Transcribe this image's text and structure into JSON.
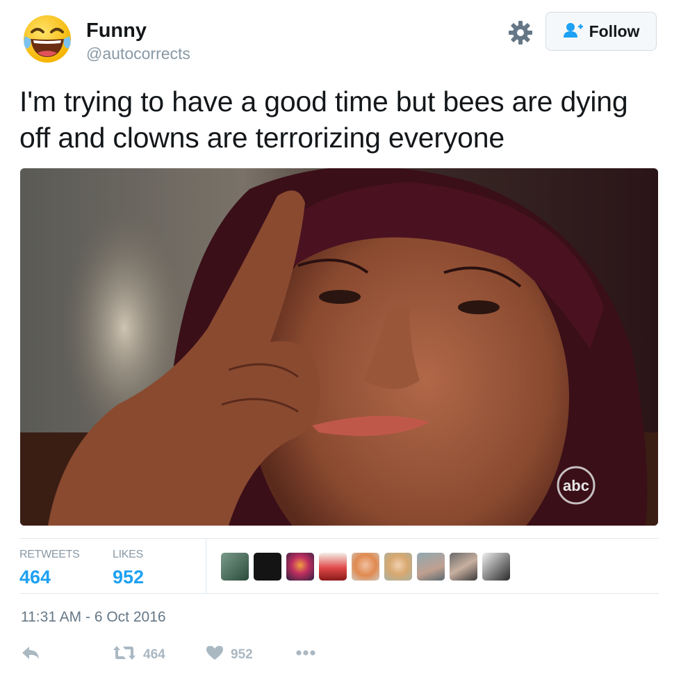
{
  "header": {
    "display_name": "Funny",
    "handle": "@autocorrects",
    "avatar_icon": "crying-laughing-emoji-icon",
    "settings_icon": "gear-icon",
    "follow_label": "Follow",
    "follow_icon": "add-user-icon"
  },
  "tweet": {
    "line1": "I'm trying to have a good time but bees are dying",
    "line2": "off and clowns are terrorizing everyone",
    "media_watermark": "abc"
  },
  "stats": {
    "retweets_label": "RETWEETS",
    "retweets_value": "464",
    "likes_label": "LIKES",
    "likes_value": "952",
    "likers": [
      "liker-avatar-1",
      "liker-avatar-2",
      "liker-avatar-3",
      "liker-avatar-4",
      "liker-avatar-5",
      "liker-avatar-6",
      "liker-avatar-7",
      "liker-avatar-8",
      "liker-avatar-9"
    ]
  },
  "timestamp": "11:31 AM - 6 Oct 2016",
  "actions": {
    "reply_icon": "reply-icon",
    "retweet_icon": "retweet-icon",
    "retweet_count": "464",
    "like_icon": "heart-icon",
    "like_count": "952",
    "more_icon": "more-dots-icon"
  },
  "colors": {
    "accent": "#1da1f2",
    "muted": "#8899a6",
    "text": "#14171a",
    "action_gray": "#aab8c2"
  }
}
